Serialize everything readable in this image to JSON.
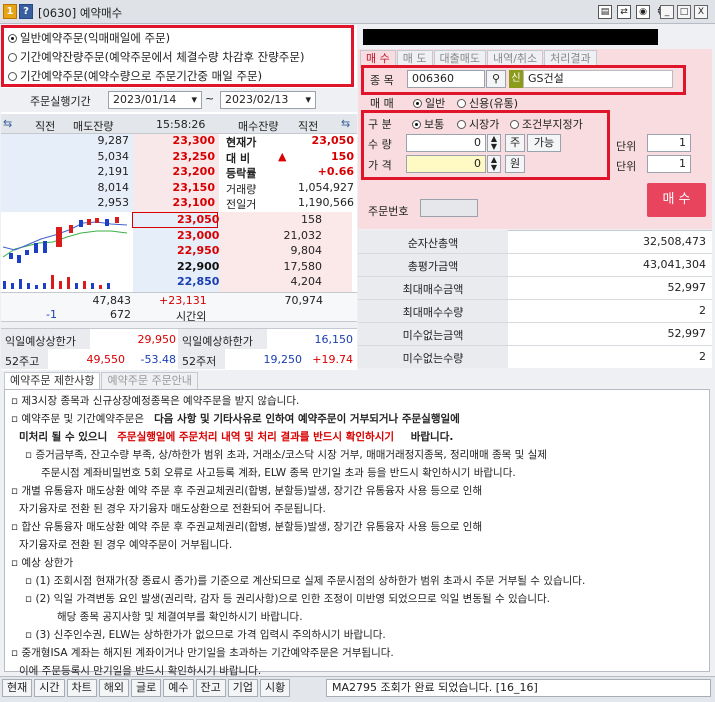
{
  "window": {
    "title": "[0630] 예약매수",
    "help_label": "?",
    "win_icons": [
      "_",
      "□",
      "X"
    ]
  },
  "top_panel": {
    "order_types": [
      {
        "label": "일반예약주문(익매매일에 주문)",
        "selected": true
      },
      {
        "label": "기간예약잔량주문(예약주문에서 체결수량 차감후 잔량주문)",
        "selected": false
      },
      {
        "label": "기간예약주문(예약수량으로 주문기간중 매일 주문)",
        "selected": false
      }
    ],
    "period_label": "주문실행기간",
    "start_date": "2023/01/14",
    "end_date": "2023/02/13",
    "tilde": "~"
  },
  "tabs": [
    "매 수",
    "매 도",
    "대출매도",
    "내역/취소",
    "처리결과"
  ],
  "order_form": {
    "stock_label": "종 목",
    "stock_code": "006360",
    "credit_badge": "신",
    "stock_name": "GS건설",
    "trade_label": "매 매",
    "trade_options": [
      "일반",
      "신용(유통)"
    ],
    "type_label": "구 분",
    "type_options": [
      "보통",
      "시장가",
      "조건부지정가"
    ],
    "qty_label": "수 량",
    "qty_value": "0",
    "qty_btn": "주",
    "available_btn": "가능",
    "price_label": "가 격",
    "price_value": "0",
    "price_btn": "원",
    "unit_label": "단위",
    "unit_value_1": "1",
    "unit_value_2": "1",
    "order_no_label": "주문번호",
    "buy_button": "매 수"
  },
  "orderbook": {
    "headers": [
      "직전",
      "매도잔량",
      "15:58:26",
      "매수잔량",
      "직전"
    ],
    "asks": [
      {
        "qty": "9,287",
        "price": "23,300"
      },
      {
        "qty": "5,034",
        "price": "23,250"
      },
      {
        "qty": "2,191",
        "price": "23,200"
      },
      {
        "qty": "8,014",
        "price": "23,150"
      },
      {
        "qty": "2,953",
        "price": "23,100"
      }
    ],
    "bids": [
      {
        "price": "23,050",
        "qty": "158"
      },
      {
        "price": "23,000",
        "qty": "21,032"
      },
      {
        "price": "22,950",
        "qty": "9,804"
      },
      {
        "price": "22,900",
        "qty": "17,580"
      },
      {
        "price": "22,850",
        "qty": "4,204"
      }
    ],
    "info": [
      {
        "label": "현재가",
        "value": "23,050"
      },
      {
        "label": "대 비",
        "value": "150"
      },
      {
        "label": "등락률",
        "value": "+0.66"
      },
      {
        "label": "거래량",
        "value": "1,054,927"
      },
      {
        "label": "전일거",
        "value": "1,190,566"
      }
    ],
    "total_ask": "47,843",
    "total_mid": "+23,131",
    "total_bid": "70,974",
    "bottom_left": "-1",
    "bottom_ask": "672",
    "after_hours": "시간외"
  },
  "limits": {
    "upper_label": "익일예상상한가",
    "upper_value": "29,950",
    "lower_label": "익일예상하한가",
    "lower_value": "16,150",
    "w52_high_label": "52주고",
    "w52_high_value": "49,550",
    "w52_high_rate": "-53.48",
    "w52_low_label": "52주저",
    "w52_low_value": "19,250",
    "w52_low_rate": "+19.74"
  },
  "account": [
    {
      "label": "순자산총액",
      "value": "32,508,473"
    },
    {
      "label": "총평가금액",
      "value": "43,041,304"
    },
    {
      "label": "최대매수금액",
      "value": "52,997"
    },
    {
      "label": "최대매수수량",
      "value": "2"
    },
    {
      "label": "미수없는금액",
      "value": "52,997"
    },
    {
      "label": "미수없는수량",
      "value": "2"
    }
  ],
  "info_tabs": [
    "예약주문 제한사항",
    "예약주문 주문안내"
  ],
  "notice": {
    "l1": "제3시장 종목과 신규상장예정종목은 예약주문을 받지 않습니다.",
    "l2a": "예약주문 및 기간예약주문은",
    "l2b": "다음 사항 및 기타사유로 인하여 예약주문이 거부되거나 주문실행일에",
    "l3a": "미처리 될 수 있으니",
    "l3b": "주문실행일에 주문처리 내역 및 처리 결과를 반드시 확인하시기",
    "l3c": "바랍니다.",
    "l4": "증거금부족, 잔고수량 부족, 상/하한가 범위 초과, 거래소/코스닥 시장 거부, 매매거래정지종목, 정리매매 종목 및 실제",
    "l5": "주문시점 계좌비밀번호 5회 오류로 사고등록 계좌, ELW 종목 만기일 초과 등을 반드시 확인하시기 바랍니다.",
    "l6": "개별 유통융자 매도상환 예약 주문 후 주권교체권리(합병, 분할등)발생, 장기간 유통융자 사용 등으로 인해",
    "l7": "자기융자로 전환 된 경우 자기융자 매도상환으로 전환되어 주문됩니다.",
    "l8": "합산 유통융자 매도상환 예약 주문 후 주권교체권리(합병, 분할등)발생, 장기간 유통융자 사용 등으로 인해",
    "l9": "자기융자로 전환 된 경우 예약주문이 거부됩니다.",
    "l10": "예상 상한가",
    "l11": "(1) 조회시점 현재가(장 종료시 종가)를 기준으로 계산되므로 실제 주문시점의 상하한가 범위 초과시 주문 거부될 수 있습니다.",
    "l12": "(2) 익일 가격변동 요인 발생(권리락, 감자 등 권리사항)으로 인한 조정이 미반영 되었으므로 익일 변동될 수 있습니다.",
    "l13": "해당 종목 공지사항 및 체결여부를 확인하시기 바랍니다.",
    "l14": "(3) 신주인수권, ELW는 상하한가가 없으므로 가격 입력시 주의하시기 바랍니다.",
    "l15": "중개형ISA 계좌는 해지된 계좌이거나 만기일을 초과하는 기간예약주문은 거부됩니다.",
    "l16": "이에 주문등록시 만기일을 반드시 확인하시기 바랍니다."
  },
  "bottom": {
    "buttons": [
      "현재",
      "시간",
      "차트",
      "해외",
      "글로",
      "예수",
      "잔고",
      "기업",
      "시황"
    ],
    "status": "MA2795 조회가 완료 되었습니다. [16_16]"
  }
}
